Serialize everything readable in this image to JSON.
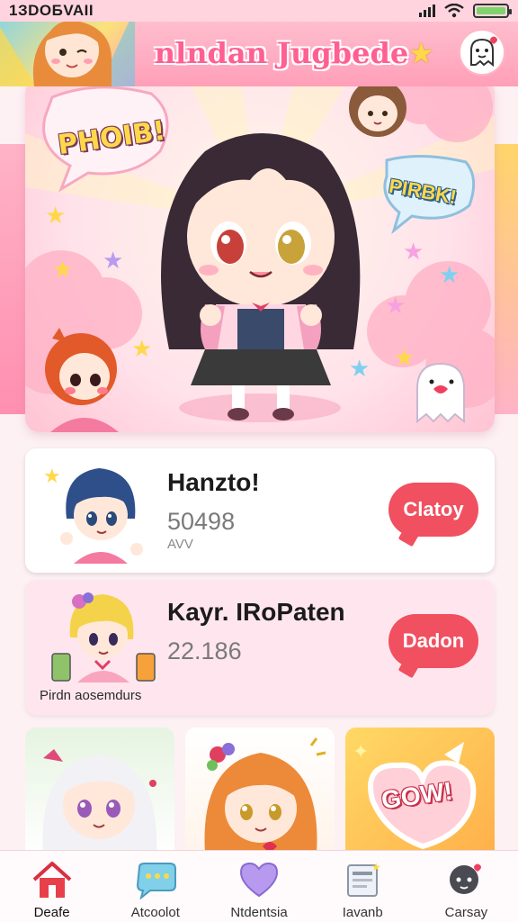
{
  "status_bar": {
    "time": "1ЗDOБVAII"
  },
  "header": {
    "title": "nlndan Jugbede"
  },
  "hero": {
    "bubble_left_text": "PHOIB!",
    "bubble_right_text": "PIRBK!"
  },
  "cards": [
    {
      "title": "Hanzto!",
      "number": "50498",
      "sub": "AVV",
      "button_label": "Clatoy"
    },
    {
      "title": "Kayr. IRoPaten",
      "number": "22.186",
      "caption": "Pirdn aosemdurs",
      "button_label": "Dadon"
    }
  ],
  "gallery": {
    "tile3_text": "GOW!"
  },
  "bottom_nav": {
    "items": [
      {
        "label": "Deafe",
        "icon": "home-icon"
      },
      {
        "label": "Atcoolot",
        "icon": "chat-icon"
      },
      {
        "label": "Ntdentsia",
        "icon": "heart-icon"
      },
      {
        "label": "Iavanb",
        "icon": "news-icon"
      },
      {
        "label": "Carsay",
        "icon": "profile-icon"
      }
    ]
  },
  "colors": {
    "accent": "#ff5f92",
    "button": "#f05060",
    "header_bg": "#ffb2c6",
    "battery": "#7fd36b"
  }
}
